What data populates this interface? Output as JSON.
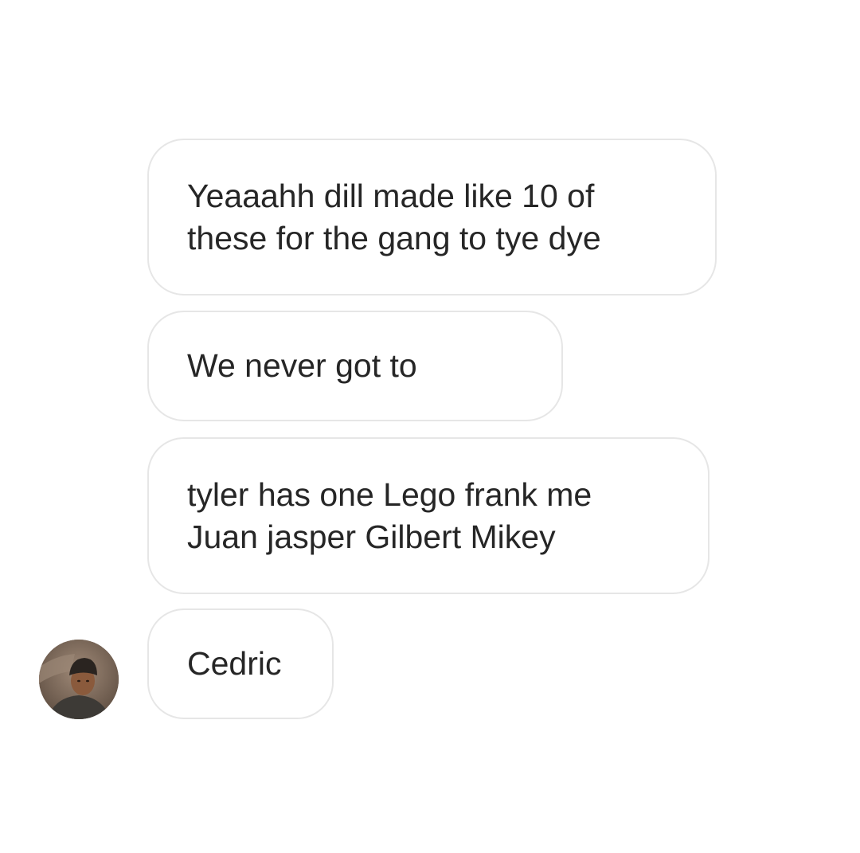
{
  "messages": [
    {
      "text": "Yeaaahh dill made like 10 of\nthese for the gang to tye dye"
    },
    {
      "text": "We never got to"
    },
    {
      "text": "tyler has one Lego frank me\nJuan jasper Gilbert Mikey"
    },
    {
      "text": "Cedric"
    }
  ],
  "avatar": {
    "icon": "profile-photo",
    "colors": {
      "background": "#6b5a4c",
      "skin": "#8a5a3c",
      "hat": "#2a2420",
      "shirt": "#3d3a36"
    }
  },
  "colors": {
    "page_background": "#ffffff",
    "bubble_border": "#e6e6e6",
    "text": "#262626"
  }
}
